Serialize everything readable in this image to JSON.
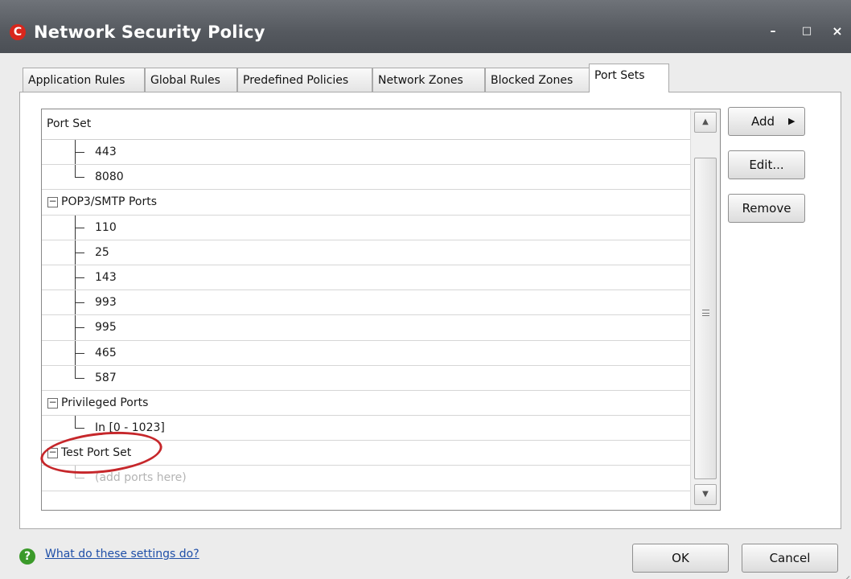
{
  "window": {
    "title": "Network Security Policy",
    "logo": "C",
    "controls": {
      "minimize": "–",
      "maximize": "□",
      "close": "×"
    }
  },
  "tabs": [
    {
      "label": "Application Rules",
      "active": false
    },
    {
      "label": "Global Rules",
      "active": false
    },
    {
      "label": "Predefined Policies",
      "active": false
    },
    {
      "label": "Network Zones",
      "active": false
    },
    {
      "label": "Blocked Zones",
      "active": false
    },
    {
      "label": "Port Sets",
      "active": true
    }
  ],
  "list": {
    "header": "Port Set",
    "rows": [
      {
        "type": "child",
        "text": "443"
      },
      {
        "type": "child",
        "text": "8080",
        "last": true
      },
      {
        "type": "group",
        "text": "POP3/SMTP Ports"
      },
      {
        "type": "child",
        "text": "110"
      },
      {
        "type": "child",
        "text": "25"
      },
      {
        "type": "child",
        "text": "143"
      },
      {
        "type": "child",
        "text": "993"
      },
      {
        "type": "child",
        "text": "995"
      },
      {
        "type": "child",
        "text": "465"
      },
      {
        "type": "child",
        "text": "587",
        "last": true
      },
      {
        "type": "group",
        "text": "Privileged Ports"
      },
      {
        "type": "child",
        "text": "In [0 - 1023]",
        "last": true
      },
      {
        "type": "group",
        "text": "Test Port Set",
        "highlighted": true
      },
      {
        "type": "placeholder",
        "text": "(add ports here)"
      }
    ]
  },
  "buttons": {
    "add": "Add",
    "edit": "Edit...",
    "remove": "Remove",
    "ok": "OK",
    "cancel": "Cancel"
  },
  "help": {
    "link_text": "What do these settings do?",
    "icon": "?"
  },
  "icons": {
    "expander": "−",
    "scroll_up": "▲",
    "scroll_down": "▼",
    "add_arrow": "▶"
  },
  "colors": {
    "titlebar": "#55595f",
    "logo": "#d9261c",
    "highlight": "#c6272b",
    "link": "#1f4fa8",
    "help_icon": "#3b9a2a"
  }
}
